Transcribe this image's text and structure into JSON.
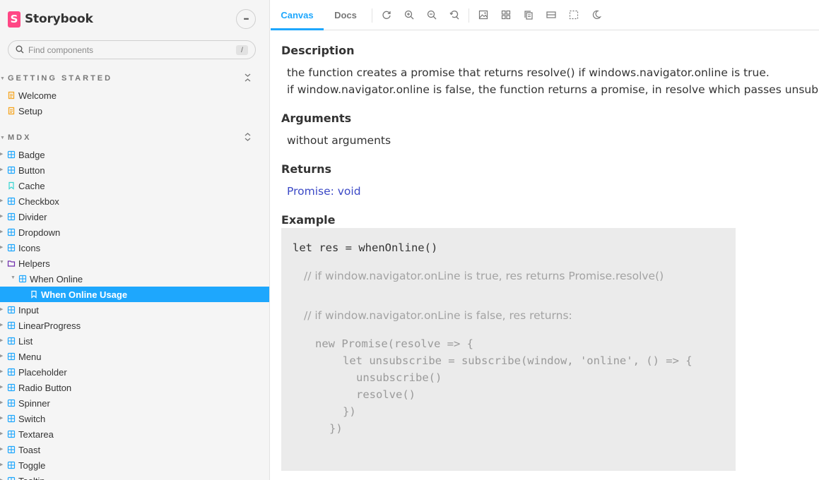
{
  "brand": {
    "logo_letter": "S",
    "name": "Storybook",
    "color": "#ff4785"
  },
  "menu_button_glyph": "•••",
  "search": {
    "placeholder": "Find components",
    "shortcut": "/"
  },
  "sidebar": {
    "sections": [
      {
        "title": "GETTING STARTED",
        "toggle_glyph": "⌃"
      },
      {
        "title": "MDX",
        "toggle_glyph": "⌃"
      }
    ],
    "getting_started": [
      {
        "label": "Welcome",
        "icon": "document-icon"
      },
      {
        "label": "Setup",
        "icon": "document-icon"
      }
    ],
    "mdx": [
      {
        "label": "Badge",
        "icon": "component-icon"
      },
      {
        "label": "Button",
        "icon": "component-icon"
      },
      {
        "label": "Cache",
        "icon": "bookmark-icon"
      },
      {
        "label": "Checkbox",
        "icon": "component-icon"
      },
      {
        "label": "Divider",
        "icon": "component-icon"
      },
      {
        "label": "Dropdown",
        "icon": "component-icon"
      },
      {
        "label": "Icons",
        "icon": "component-icon"
      },
      {
        "label": "Helpers",
        "icon": "folder-icon"
      },
      {
        "label": "When Online",
        "icon": "component-icon"
      },
      {
        "label": "When Online Usage",
        "icon": "bookmark-icon",
        "selected": true
      },
      {
        "label": "Input",
        "icon": "component-icon"
      },
      {
        "label": "LinearProgress",
        "icon": "component-icon"
      },
      {
        "label": "List",
        "icon": "component-icon"
      },
      {
        "label": "Menu",
        "icon": "component-icon"
      },
      {
        "label": "Placeholder",
        "icon": "component-icon"
      },
      {
        "label": "Radio Button",
        "icon": "component-icon"
      },
      {
        "label": "Spinner",
        "icon": "component-icon"
      },
      {
        "label": "Switch",
        "icon": "component-icon"
      },
      {
        "label": "Textarea",
        "icon": "component-icon"
      },
      {
        "label": "Toast",
        "icon": "component-icon"
      },
      {
        "label": "Toggle",
        "icon": "component-icon"
      },
      {
        "label": "Tooltip",
        "icon": "component-icon"
      }
    ]
  },
  "toolbar": {
    "tabs": [
      {
        "label": "Canvas",
        "active": true
      },
      {
        "label": "Docs",
        "active": false
      }
    ],
    "tools": [
      "reload-icon",
      "zoom-in-icon",
      "zoom-out-icon",
      "zoom-reset-icon",
      "background-icon",
      "grid-icon",
      "viewport-icon",
      "measure-icon",
      "outline-icon",
      "theme-icon"
    ]
  },
  "doc": {
    "description_heading": "Description",
    "description_lines": [
      "the function creates a promise that returns resolve() if windows.navigator.online is true.",
      "if window.navigator.online is false, the function returns a promise, in resolve which passes unsubscribe"
    ],
    "arguments_heading": "Arguments",
    "arguments_text": "without arguments",
    "returns_heading": "Returns",
    "returns_text": "Promise: void",
    "example_heading": "Example",
    "code": {
      "line1": "let res = whenOnline()",
      "comment1": "// if window.navigator.onLine is true, res returns Promise.resolve()",
      "comment2": "// if window.navigator.onLine is false, res returns:",
      "line2": "new Promise(resolve => {",
      "line3": "let unsubscribe = subscribe(window, 'online', () => {",
      "line4": "unsubscribe()",
      "line5": "resolve()",
      "line6": "})",
      "line7": "})"
    }
  },
  "colors": {
    "accent": "#1ea7fd",
    "sidebar_bg": "#f5f5f5",
    "link": "#3b49c6",
    "code_bg": "#ebebeb",
    "document_icon": "#f5a623",
    "component_icon": "#1ea7fd",
    "bookmark_icon": "#37d5d3",
    "folder_icon": "#6f2cac"
  }
}
